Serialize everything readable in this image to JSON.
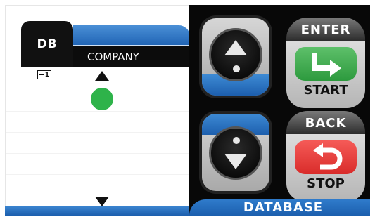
{
  "screen": {
    "tab_label": "DB",
    "header_title": "COMPANY",
    "page_indicator": "1",
    "status_color": "#2eb34a"
  },
  "controls": {
    "enter_label": "ENTER",
    "start_label": "START",
    "back_label": "BACK",
    "stop_label": "STOP",
    "footer_label": "DATABASE",
    "icons": {
      "up": "triangle-up-icon",
      "down": "triangle-down-icon",
      "enter": "enter-arrow-icon",
      "back": "return-arrow-icon"
    }
  },
  "colors": {
    "accent_blue": "#1e62b3",
    "start_green": "#2d9a3e",
    "stop_red": "#d92c2a",
    "panel_black": "#080808"
  }
}
